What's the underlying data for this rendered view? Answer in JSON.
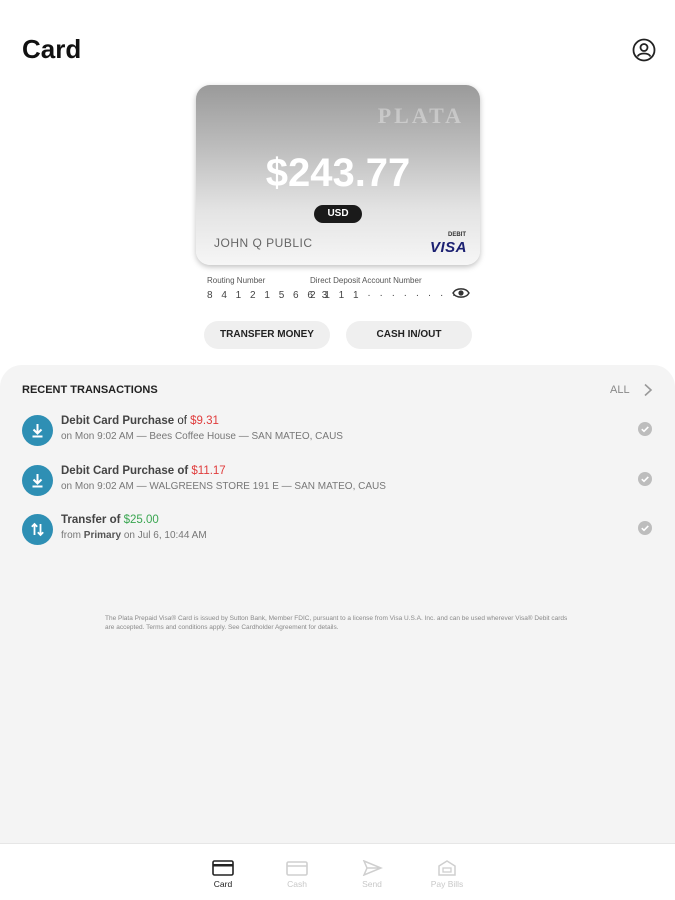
{
  "header": {
    "title": "Card",
    "profile_icon": "account-circle-icon"
  },
  "card": {
    "brand": "PLATA",
    "balance": "$243.77",
    "currency": "USD",
    "holder": "JOHN Q PUBLIC",
    "debit_label": "DEBIT",
    "network": "VISA"
  },
  "account": {
    "routing_label": "Routing Number",
    "routing_value": "8 4 1 2 1 5 6 6 3",
    "deposit_label": "Direct Deposit Account Number",
    "deposit_value": "2 1 1 1 · · · · · · · ·",
    "reveal_icon": "eye-icon"
  },
  "actions": {
    "transfer": "TRANSFER MONEY",
    "cash": "CASH IN/OUT"
  },
  "transactions": {
    "title": "RECENT TRANSACTIONS",
    "all_label": "ALL",
    "items": [
      {
        "icon": "download-icon",
        "type": "Debit Card Purchase",
        "of": "of",
        "amount": "$9.31",
        "detail": "on Mon 9:02 AM — Bees Coffee House — SAN MATEO, CAUS"
      },
      {
        "icon": "download-icon",
        "type": "Debit Card Purchase of",
        "amount": "$11.17",
        "detail": "on Mon 9:02 AM — WALGREENS STORE 191 E — SAN MATEO, CAUS"
      },
      {
        "icon": "transfer-icon",
        "type": "Transfer of",
        "amount": "$25.00",
        "from_prefix": "from",
        "from_account": "Primary",
        "from_suffix": "on Jul 6, 10:44 AM"
      }
    ],
    "disclaimer": "The Plata Prepaid Visa® Card is issued by Sutton Bank, Member FDIC, pursuant to a license from Visa U.S.A. Inc. and can be used wherever Visa® Debit cards are accepted. Terms and conditions apply. See Cardholder Agreement for details."
  },
  "nav": {
    "items": [
      {
        "label": "Card",
        "icon": "card-icon"
      },
      {
        "label": "Cash",
        "icon": "wallet-icon"
      },
      {
        "label": "Send",
        "icon": "send-icon"
      },
      {
        "label": "Pay Bills",
        "icon": "bills-icon"
      }
    ]
  },
  "colors": {
    "accent": "#2e8fb4",
    "negative": "#e03c3c",
    "positive": "#3aa651"
  }
}
